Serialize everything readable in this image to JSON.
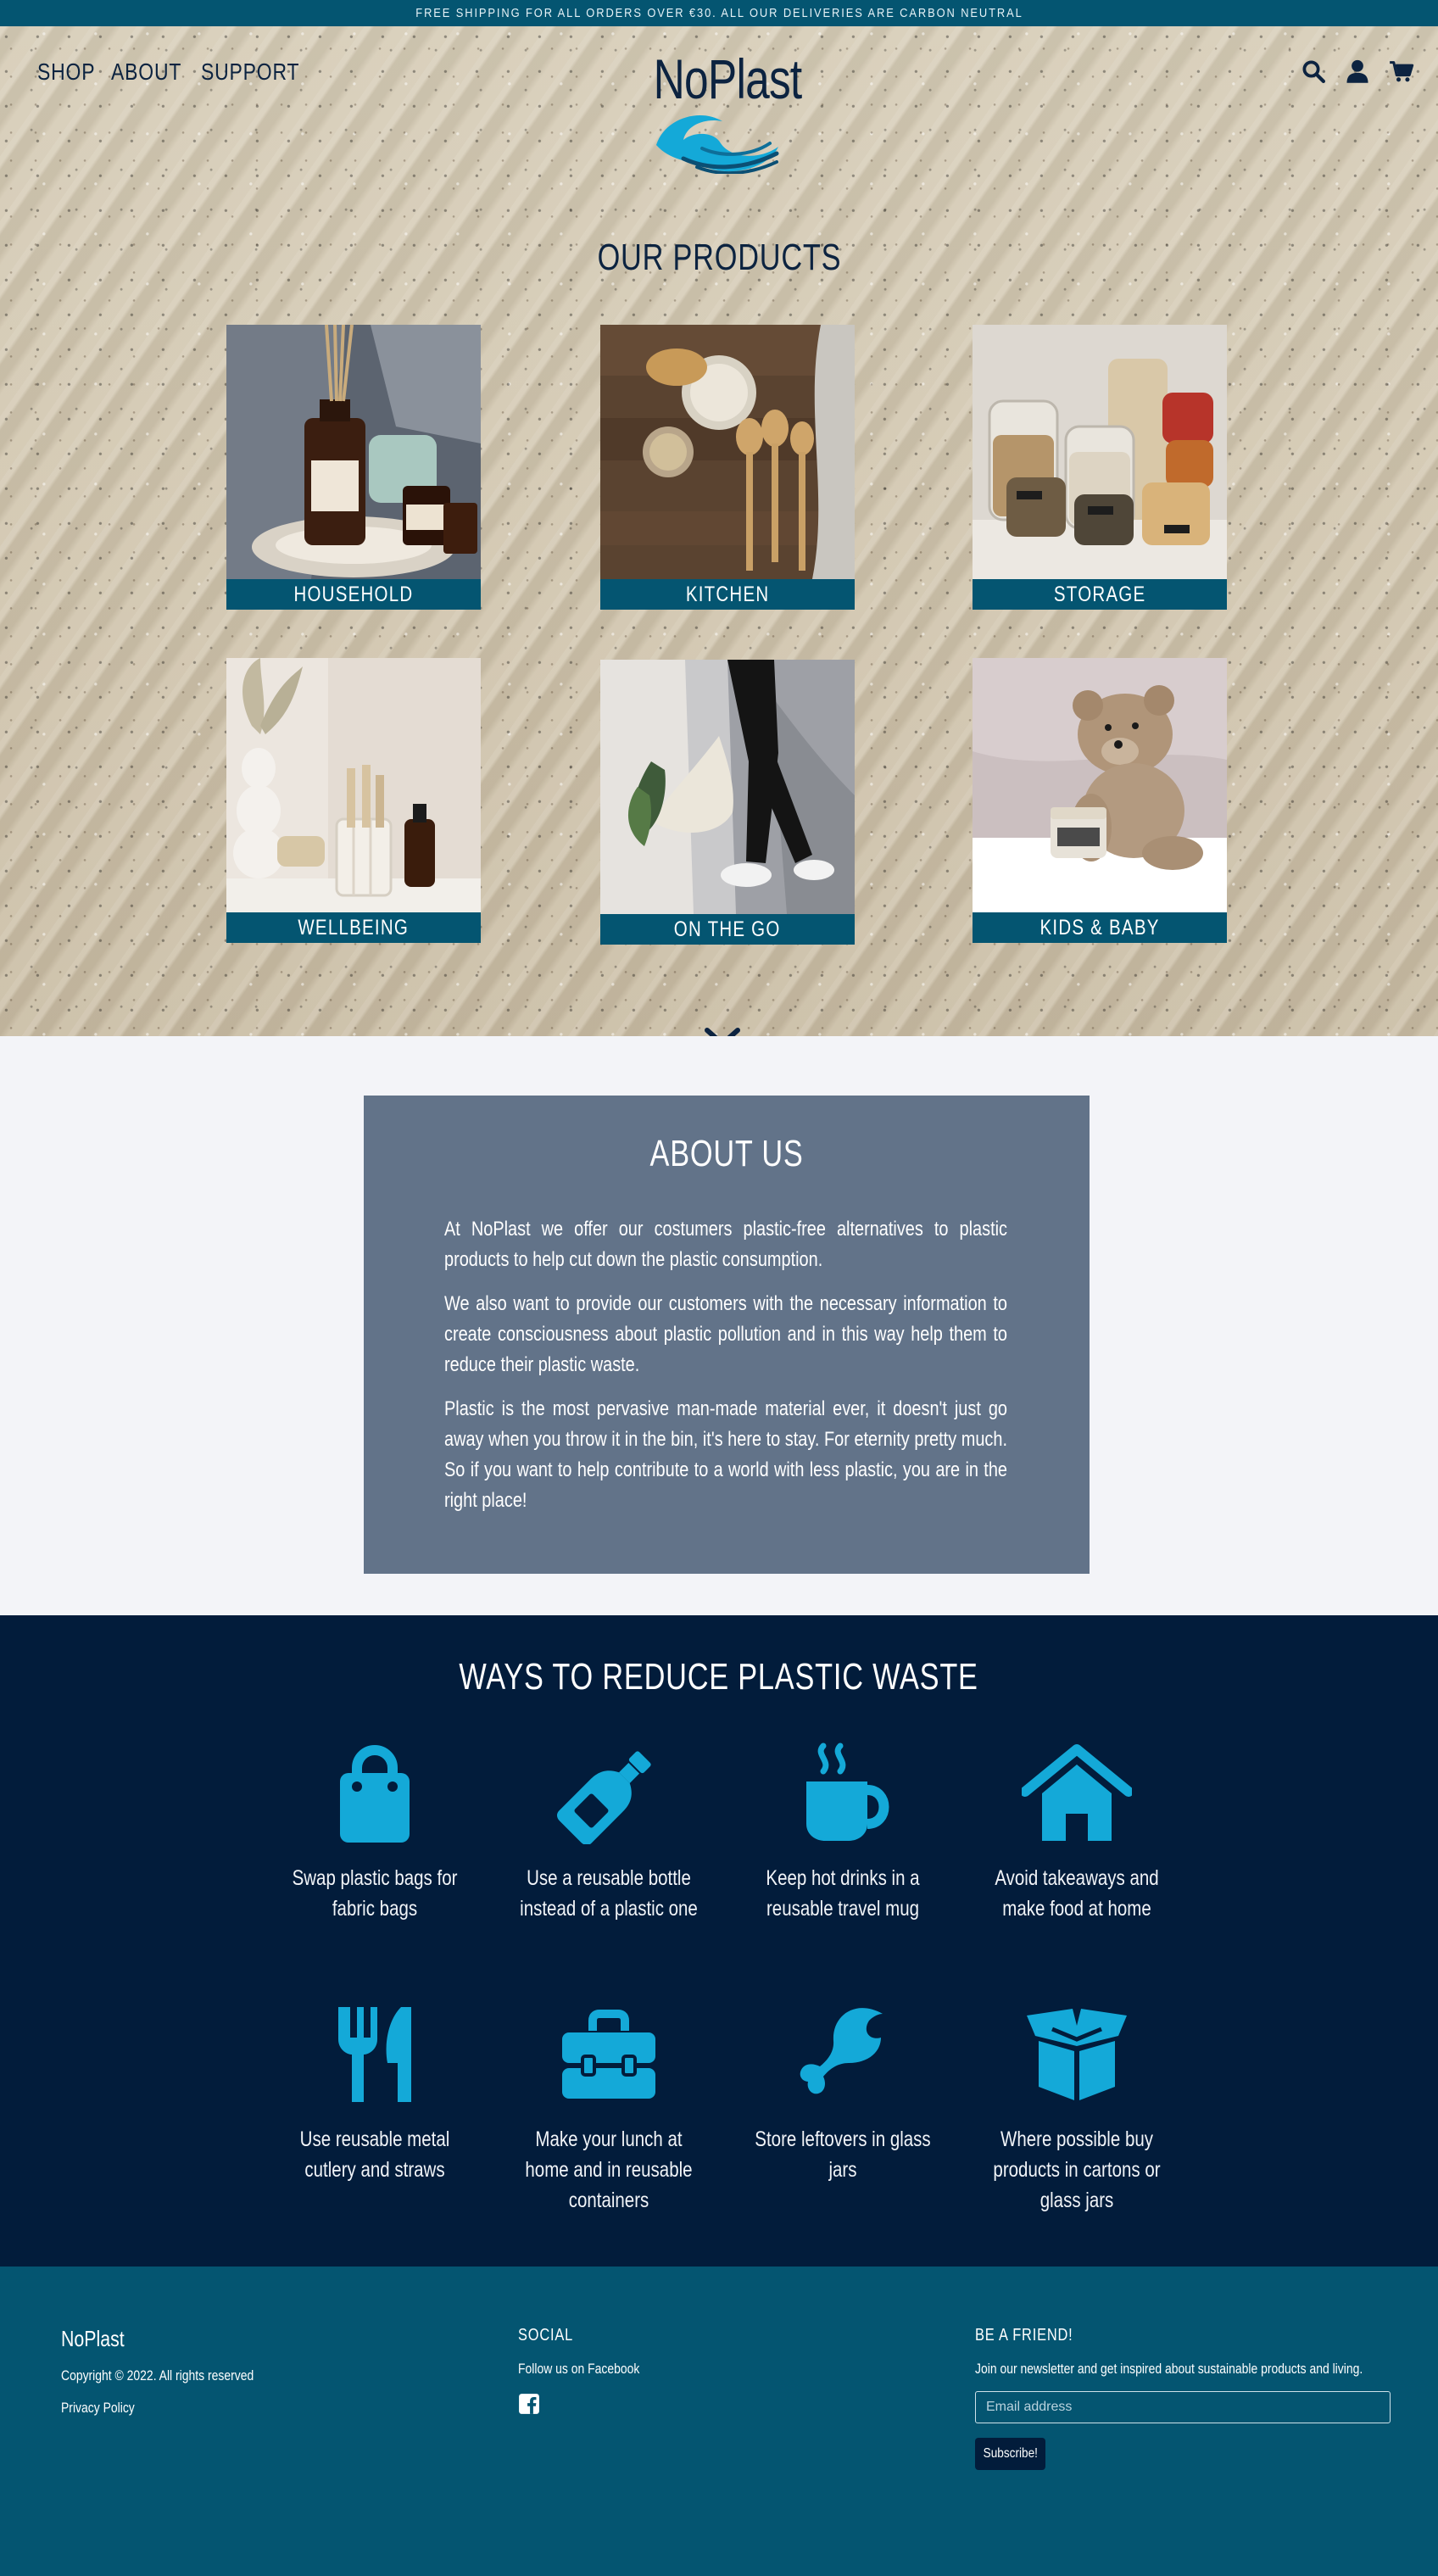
{
  "banner": {
    "text": "FREE SHIPPING FOR ALL ORDERS OVER €30. ALL OUR DELIVERIES ARE CARBON NEUTRAL"
  },
  "nav": {
    "links": [
      "SHOP",
      "ABOUT",
      "SUPPORT"
    ],
    "logo_text": "NoPlast",
    "icons": [
      "search-icon",
      "user-icon",
      "cart-icon"
    ]
  },
  "products": {
    "title": "OUR PRODUCTS",
    "items": [
      {
        "label": "HOUSEHOLD"
      },
      {
        "label": "KITCHEN"
      },
      {
        "label": "STORAGE"
      },
      {
        "label": "WELLBEING"
      },
      {
        "label": "ON THE GO"
      },
      {
        "label": "KIDS & BABY"
      }
    ]
  },
  "about": {
    "title": "ABOUT US",
    "paragraphs": [
      "At NoPlast we offer our costumers plastic-free alternatives to plastic products to help cut down the plastic consumption.",
      "We also want to provide our customers with the necessary information to create consciousness about plastic pollution and in this way help them to reduce their plastic waste.",
      "Plastic is the most pervasive man-made material ever, it doesn't just go away when you throw it in the bin, it's here to stay. For eternity pretty much. So if you want to help contribute to a world with less plastic, you are in the right place!"
    ]
  },
  "ways": {
    "title": "WAYS TO REDUCE PLASTIC WASTE",
    "items": [
      {
        "icon": "shopping-bag-icon",
        "text": "Swap plastic bags for fabric bags"
      },
      {
        "icon": "bottle-icon",
        "text": "Use a reusable bottle instead of a plastic one"
      },
      {
        "icon": "mug-hot-icon",
        "text": "Keep hot drinks in a reusable travel mug"
      },
      {
        "icon": "home-icon",
        "text": "Avoid takeaways and make food at home"
      },
      {
        "icon": "utensils-icon",
        "text": "Use reusable metal cutlery and straws"
      },
      {
        "icon": "toolbox-icon",
        "text": "Make your lunch at home and in reusable containers"
      },
      {
        "icon": "drumstick-icon",
        "text": "Store leftovers in glass jars"
      },
      {
        "icon": "box-open-icon",
        "text": "Where possible buy products in cartons or glass jars"
      }
    ]
  },
  "footer": {
    "brand": "NoPlast",
    "copyright": "Copyright © 2022. All rights reserved",
    "privacy": "Privacy Policy",
    "social_head": "SOCIAL",
    "social_text": "Follow us on Facebook",
    "newsletter_head": "BE A FRIEND!",
    "newsletter_text": "Join our newsletter and get inspired about sustainable products and living.",
    "email_placeholder": "Email address",
    "subscribe_label": "Subscribe!"
  },
  "colors": {
    "teal": "#045571",
    "navy": "#021c3b",
    "slate": "#627389",
    "accent": "#14a9d8",
    "light_bg": "#f3f4f8"
  }
}
